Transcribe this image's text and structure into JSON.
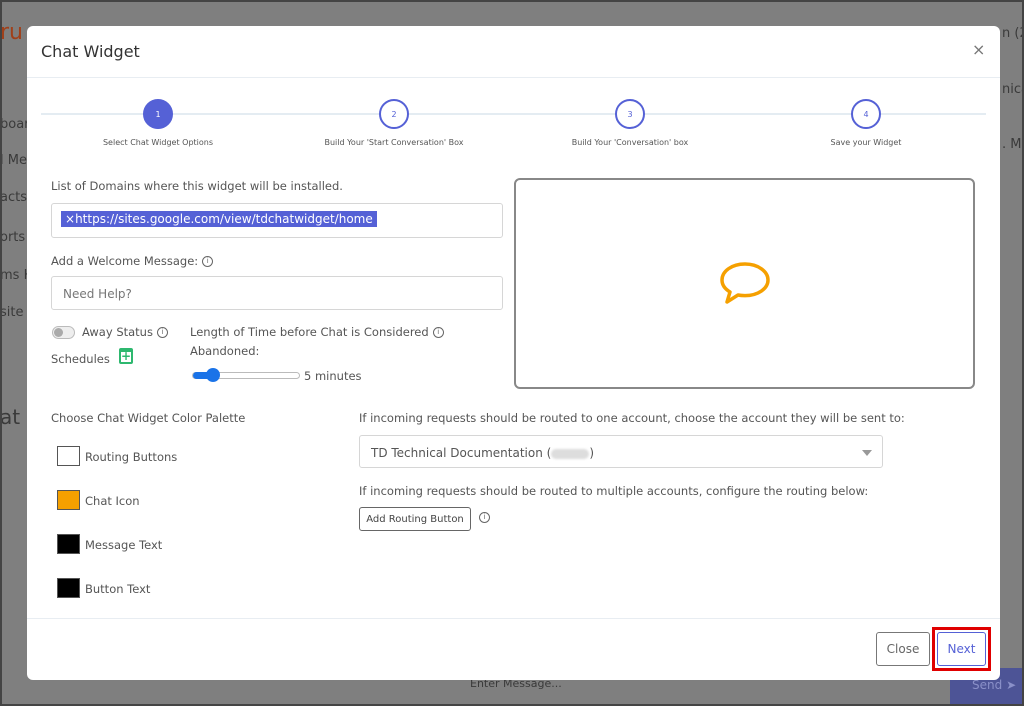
{
  "background": {
    "logo_fragment": "ru",
    "sidebar_fragments": [
      "board",
      "l Mes",
      "acts",
      "orts",
      "ms H",
      "site V",
      "at M"
    ],
    "right_fragments": [
      "n (2",
      "nicat",
      ". Me"
    ],
    "message_placeholder": "Enter Message...",
    "send_label": "Send",
    "send_arrow": "➤"
  },
  "modal": {
    "title": "Chat Widget",
    "close_icon": "×",
    "steps": [
      {
        "number": "1",
        "label": "Select Chat Widget Options",
        "active": true
      },
      {
        "number": "2",
        "label": "Build Your 'Start Conversation' Box",
        "active": false
      },
      {
        "number": "3",
        "label": "Build Your 'Conversation' box",
        "active": false
      },
      {
        "number": "4",
        "label": "Save your Widget",
        "active": false
      }
    ],
    "domains": {
      "label": "List of Domains where this widget will be installed.",
      "chip_remove": "×",
      "chip_value": "https://sites.google.com/view/tdchatwidget/home"
    },
    "welcome": {
      "label": "Add a Welcome Message:",
      "placeholder": "Need Help?"
    },
    "away_status": {
      "label": "Away Status",
      "on": false
    },
    "schedules": {
      "label": "Schedules"
    },
    "abandon": {
      "label_line1": "Length of Time before Chat is Considered",
      "label_line2": "Abandoned:",
      "value_text": "5 minutes",
      "slider_fraction": 0.12
    },
    "info_glyph": "i",
    "preview": {
      "icon": "chat-bubble-icon",
      "icon_color": "#f5a000"
    },
    "palette": {
      "label": "Choose Chat Widget Color Palette",
      "items": [
        {
          "label": "Routing Buttons",
          "color": "#ffffff"
        },
        {
          "label": "Chat Icon",
          "color": "#f5a000"
        },
        {
          "label": "Message Text",
          "color": "#000000"
        },
        {
          "label": "Button Text",
          "color": "#000000"
        }
      ]
    },
    "routing": {
      "single_label": "If incoming requests should be routed to one account, choose the account they will be sent to:",
      "selected_account": "TD Technical Documentation (",
      "selected_account_close": ")",
      "multi_label": "If incoming requests should be routed to multiple accounts, configure the routing below:",
      "add_button": "Add Routing Button"
    },
    "footer": {
      "close": "Close",
      "next": "Next"
    },
    "accent": "#5561d6",
    "highlight": "#e00000"
  }
}
